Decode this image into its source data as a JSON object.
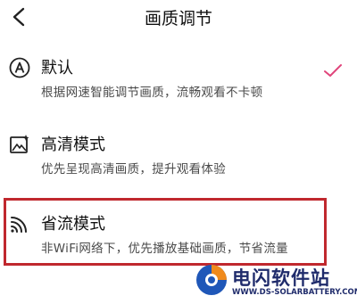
{
  "header": {
    "title": "画质调节"
  },
  "options": [
    {
      "title": "默认",
      "desc": "根据网速智能调节画质，流畅观看不卡顿",
      "selected": true
    },
    {
      "title": "高清模式",
      "desc": "优先呈现高清画质，提升观看体验",
      "selected": false
    },
    {
      "title": "省流模式",
      "desc": "非WiFi网络下，优先播放基础画质，节省流量",
      "selected": false,
      "highlighted": true
    }
  ],
  "watermark": {
    "name": "电闪软件站",
    "url": "WWW.DS-SOLARBATTERY.COM"
  },
  "colors": {
    "check": "#e0457b",
    "highlight": "#c0282e",
    "brand_blue": "#1f2b6b",
    "brand_orange": "#f08a1c"
  },
  "icons": [
    "back-arrow-icon",
    "auto-a-icon",
    "hd-image-icon",
    "signal-icon",
    "checkmark-icon",
    "watermark-logo-icon"
  ]
}
